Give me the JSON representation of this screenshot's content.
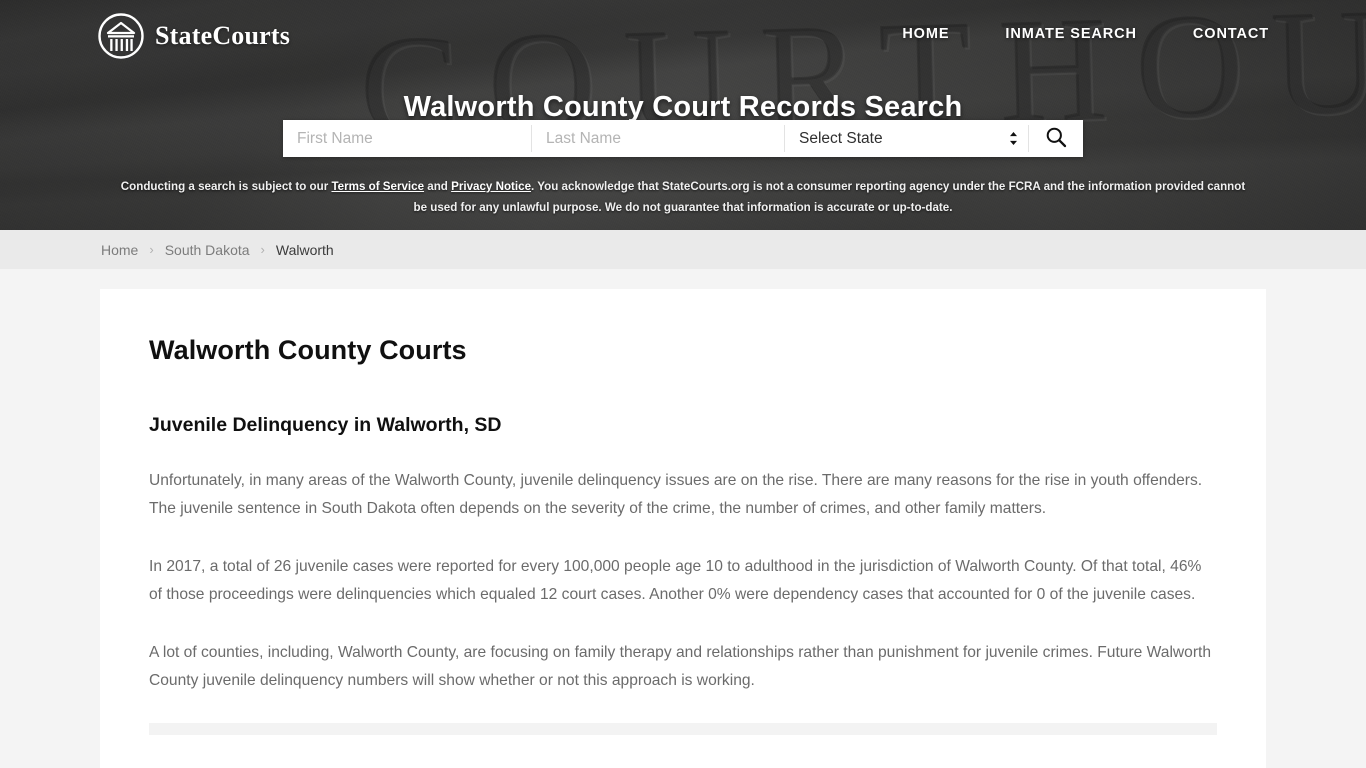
{
  "brand": {
    "name": "StateCourts",
    "logo_icon": "courthouse-circle-icon"
  },
  "nav": {
    "items": [
      {
        "label": "HOME",
        "name": "nav-home"
      },
      {
        "label": "INMATE SEARCH",
        "name": "nav-inmate-search"
      },
      {
        "label": "CONTACT",
        "name": "nav-contact"
      }
    ]
  },
  "hero": {
    "title": "Walworth County Court Records Search",
    "background_engraving": "COURTHOUSE",
    "background_color": "#5f5f5d"
  },
  "search": {
    "first_name_placeholder": "First Name",
    "first_name_value": "",
    "last_name_placeholder": "Last Name",
    "last_name_value": "",
    "state_selected": "Select State",
    "state_options": [
      "Select State"
    ],
    "submit_icon": "search-icon"
  },
  "disclaimer": {
    "part1": "Conducting a search is subject to our ",
    "link1": "Terms of Service",
    "part2": " and ",
    "link2": "Privacy Notice",
    "part3": ". You acknowledge that StateCourts.org is not a consumer reporting agency under the FCRA and the information provided cannot be used for any unlawful purpose. We do not guarantee that information is accurate or up-to-date."
  },
  "breadcrumb": {
    "items": [
      {
        "label": "Home",
        "current": false
      },
      {
        "label": "South Dakota",
        "current": false
      },
      {
        "label": "Walworth",
        "current": true
      }
    ],
    "separator": "›"
  },
  "main": {
    "page_title": "Walworth County Courts",
    "section_heading": "Juvenile Delinquency in Walworth, SD",
    "paragraphs": [
      "Unfortunately, in many areas of the Walworth County, juvenile delinquency issues are on the rise. There are many reasons for the rise in youth offenders. The juvenile sentence in South Dakota often depends on the severity of the crime, the number of crimes, and other family matters.",
      "In 2017, a total of 26 juvenile cases were reported for every 100,000 people age 10 to adulthood in the jurisdiction of Walworth County. Of that total, 46% of those proceedings were delinquencies which equaled 12 court cases. Another 0% were dependency cases that accounted for 0 of the juvenile cases.",
      "A lot of counties, including, Walworth County, are focusing on family therapy and relationships rather than punishment for juvenile crimes. Future Walworth County juvenile delinquency numbers will show whether or not this approach is working."
    ]
  }
}
